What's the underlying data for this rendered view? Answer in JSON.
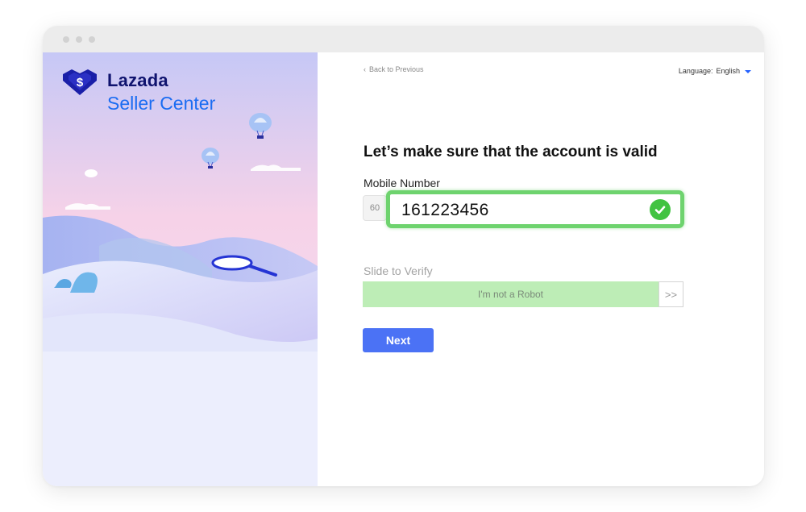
{
  "brand": {
    "name": "Lazada",
    "subtitle": "Seller Center",
    "icon": "lazada-heart-logo"
  },
  "nav": {
    "back_label": "Back to Previous",
    "language_label": "Language:",
    "language_value": "English"
  },
  "form": {
    "title": "Let’s make sure that the account is valid",
    "mobile_label": "Mobile Number",
    "country_code": "60",
    "phone_value": "161223456",
    "slide_label": "Slide to Verify",
    "slider_text": "I'm not a Robot",
    "slider_handle": ">>",
    "next_label": "Next"
  },
  "colors": {
    "accent": "#4b72f5",
    "valid_green": "#41c341",
    "slider_green": "#bdedb6",
    "brand_navy": "#0f136e",
    "brand_blue": "#1a6cf2"
  }
}
